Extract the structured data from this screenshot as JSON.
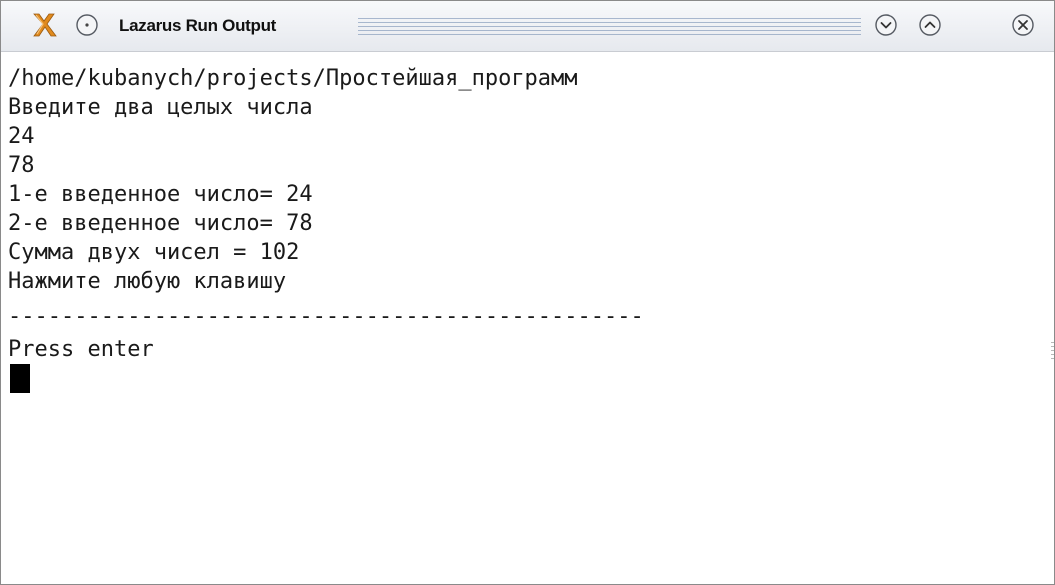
{
  "window": {
    "title": "Lazarus Run Output",
    "title_color": "#111111",
    "titlebar_color": "#eceef2"
  },
  "titlebar_icons": {
    "app": "x-app-icon",
    "menu": "window-menu-icon",
    "minimize": "minimize-icon",
    "maximize": "maximize-icon",
    "close": "close-icon"
  },
  "terminal": {
    "lines": [
      "/home/kubanych/projects/Простейшая_программ",
      "Введите два целых числа",
      "24",
      "78",
      "1-е введенное число= 24",
      "2-е введенное число= 78",
      "Сумма двух чисел = 102",
      "Нажмите любую клавишу",
      "------------------------------------------------",
      "Press enter"
    ],
    "text_color": "#1a1a1a",
    "background": "#ffffff",
    "cursor_color": "#000000"
  }
}
